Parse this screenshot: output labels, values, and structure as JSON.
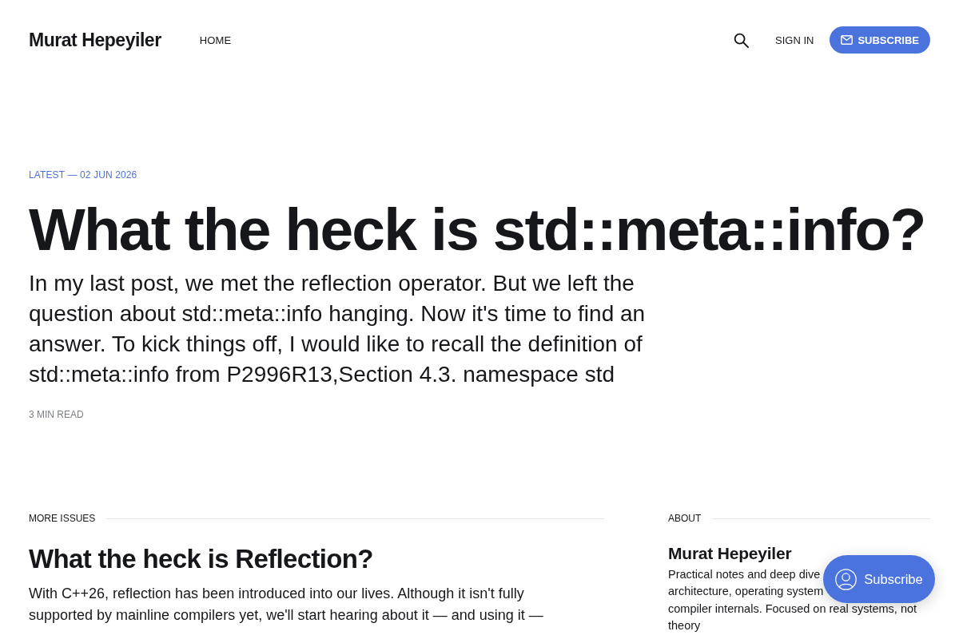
{
  "header": {
    "brand": "Murat Hepeyiler",
    "nav": [
      {
        "label": "HOME"
      }
    ],
    "sign_in": "SIGN IN",
    "subscribe": "SUBSCRIBE"
  },
  "featured": {
    "label": "LATEST — 02 JUN 2026",
    "title": "What the heck is std::meta::info?",
    "excerpt": "In my last post, we met the reflection operator. But we left the question about std::meta::info hanging. Now it's time to find an answer. To kick things off, I would like to recall the definition of std::meta::info from P2996R13,Section 4.3. namespace std",
    "reading_time": "3 MIN READ"
  },
  "more_issues": {
    "heading": "MORE ISSUES",
    "posts": [
      {
        "title": "What the heck is Reflection?",
        "excerpt": "With C++26, reflection has been introduced into our lives. Although it isn't fully supported by mainline compilers yet, we'll start hearing about it — and using it —"
      }
    ]
  },
  "about": {
    "heading": "ABOUT",
    "name": "Murat Hepeyiler",
    "bio_lines": [
      "Practical notes and deep dive",
      "architecture, operating system",
      "compiler internals. Focused on real systems, not",
      "theory"
    ]
  },
  "floating_subscribe": {
    "label": "Subscribe"
  }
}
